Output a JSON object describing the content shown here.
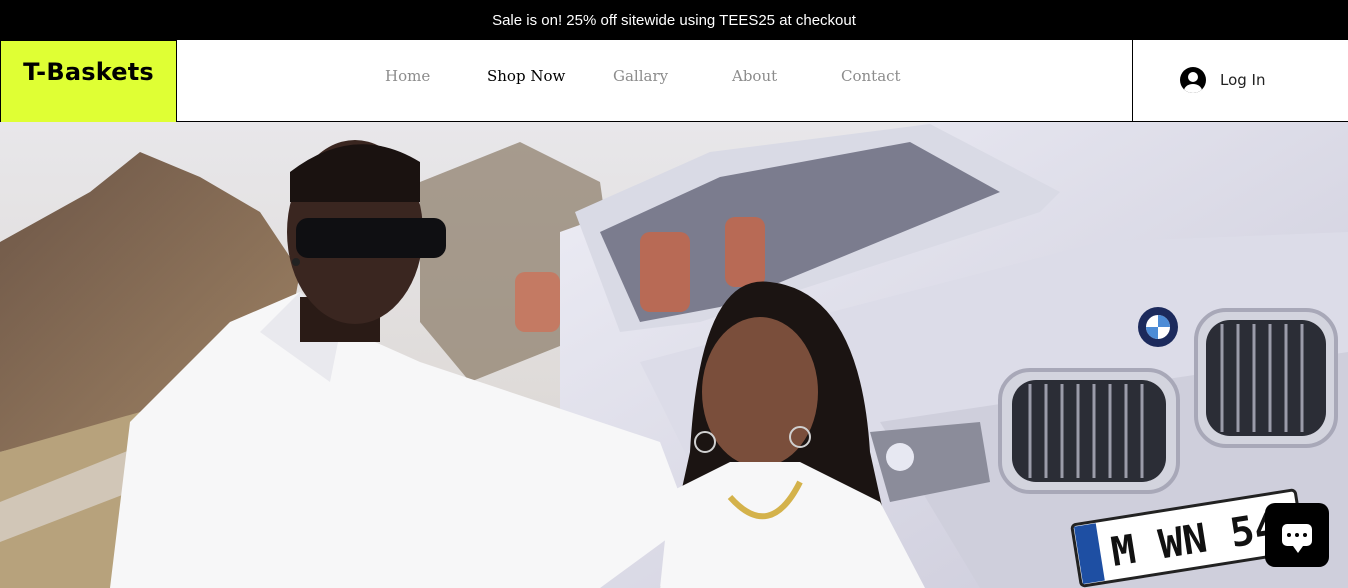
{
  "promo": {
    "text": "Sale is on! 25% off sitewide using TEES25 at checkout"
  },
  "brand": {
    "name": "T-Baskets",
    "accent": "#dfff34"
  },
  "nav": {
    "items": [
      {
        "label": "Home"
      },
      {
        "label": "Shop Now"
      },
      {
        "label": "Gallary"
      },
      {
        "label": "About"
      },
      {
        "label": "Contact"
      }
    ],
    "active": "Shop Now"
  },
  "account": {
    "login_label": "Log In",
    "icon": "user-avatar-icon"
  },
  "hero": {
    "plate_text": "M WN 5493"
  },
  "chat": {
    "icon": "chat-icon"
  }
}
